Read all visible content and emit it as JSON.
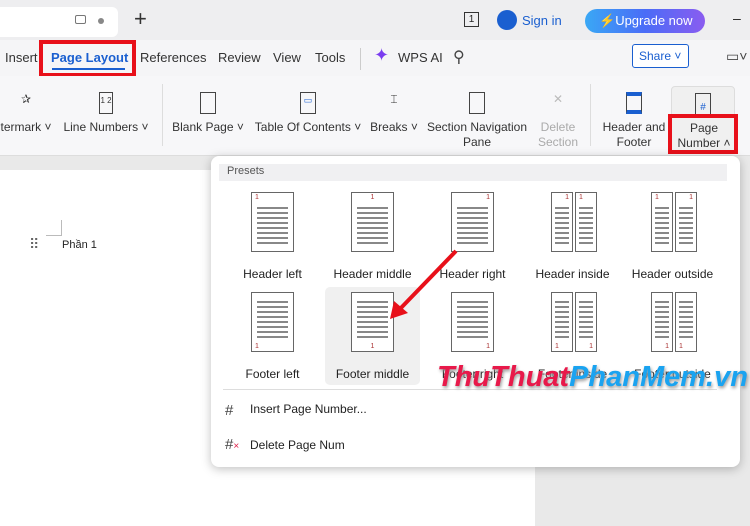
{
  "titlebar": {
    "new_tab": "+",
    "page_count": "1",
    "sign_in": "Sign in",
    "upgrade": "Upgrade now",
    "minimize": "–"
  },
  "tabs": [
    "Insert",
    "Page Layout",
    "References",
    "Review",
    "View",
    "Tools"
  ],
  "wps_ai": "WPS AI",
  "share": "Share",
  "ribbon": {
    "watermark": "termark",
    "line_numbers": "Line Numbers",
    "blank_page": "Blank Page",
    "toc": "Table Of Contents",
    "breaks": "Breaks",
    "section_nav": [
      "Section Navigation",
      "Pane"
    ],
    "delete_section": [
      "Delete",
      "Section"
    ],
    "header_footer": [
      "Header and",
      "Footer"
    ],
    "page_number": [
      "Page",
      "Number"
    ]
  },
  "document": {
    "section_label": "Phần 1"
  },
  "dropdown": {
    "presets_label": "Presets",
    "presets": [
      {
        "label": "Header left",
        "pos": "top",
        "align": "left",
        "split": false
      },
      {
        "label": "Header middle",
        "pos": "top",
        "align": "center",
        "split": false
      },
      {
        "label": "Header right",
        "pos": "top",
        "align": "right",
        "split": false
      },
      {
        "label": "Header inside",
        "pos": "top",
        "align": "inside",
        "split": true
      },
      {
        "label": "Header outside",
        "pos": "top",
        "align": "outside",
        "split": true
      },
      {
        "label": "Footer left",
        "pos": "bottom",
        "align": "left",
        "split": false
      },
      {
        "label": "Footer middle",
        "pos": "bottom",
        "align": "center",
        "split": false,
        "selected": true
      },
      {
        "label": "Footer right",
        "pos": "bottom",
        "align": "right",
        "split": false
      },
      {
        "label": "Footer inside",
        "pos": "bottom",
        "align": "inside",
        "split": true
      },
      {
        "label": "Footer outside",
        "pos": "bottom",
        "align": "outside",
        "split": true
      }
    ],
    "insert_page_number": "Insert Page Number...",
    "delete_page_num": "Delete Page Num"
  },
  "watermark_logo": "ThuThuatPhanMem.vn",
  "colors": {
    "accent": "#1a5fd0",
    "highlight": "#e8101a"
  }
}
